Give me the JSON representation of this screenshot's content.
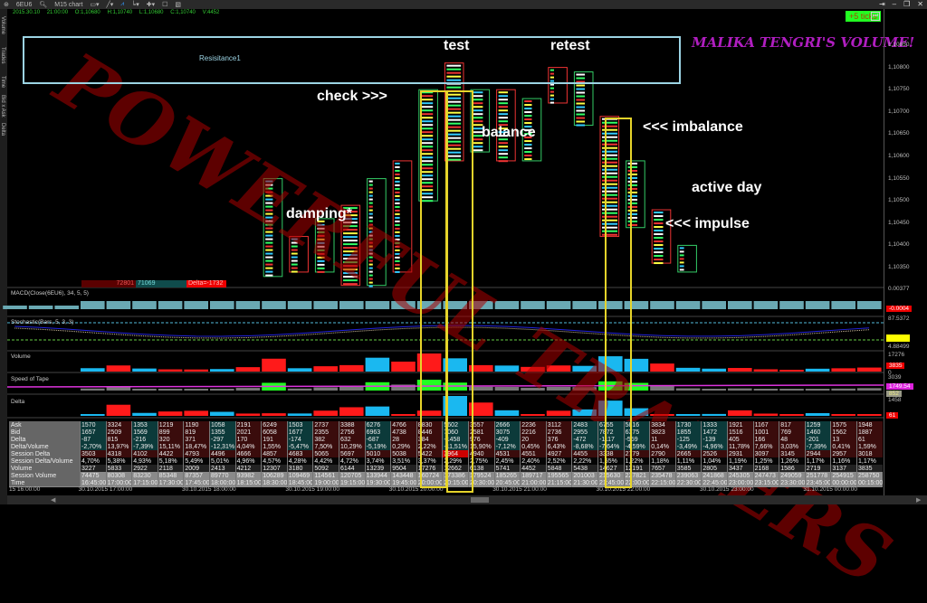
{
  "toolbar": {
    "symbol": "6EU6",
    "chart_type": "M15 chart",
    "items": [
      "search-icon",
      "monitor-icon",
      "draw-icon",
      "indicator-icon",
      "layout-icon",
      "crosshair-icon",
      "window-icon",
      "template-icon"
    ]
  },
  "info": {
    "datetime": "2015.30.10 21:00:00",
    "open": "O:1,10680",
    "high": "H:1,10740",
    "low": "L:1,10680",
    "close": "C:1,10740",
    "volume": "V:4452"
  },
  "left_tabs": [
    "Volume",
    "Trades",
    "Time",
    "Bid x Ask",
    "Delta"
  ],
  "ticks_button": "+5 ticks",
  "title_overlay": "MALIKA TENGRI'S VOLUME!",
  "watermark": "POWERFUL TRADERS",
  "resistance_label": "Resisitance1",
  "annotations": {
    "test": "test",
    "retest": "retest",
    "check": "check >>>",
    "balance": "balance",
    "imbalance": "<<< imbalance",
    "active": "active day",
    "damping": "damping*",
    "impulse": "<<< impulse"
  },
  "price_axis": [
    "1,10850",
    "1,10800",
    "1,10750",
    "1,10700",
    "1,10650",
    "1,10600",
    "1,10550",
    "1,10500",
    "1,10450",
    "1,10400",
    "1,10350"
  ],
  "bottom_bar": {
    "ask_total": "72801",
    "bid_total": "71069",
    "delta": "Delta=-1732"
  },
  "panels": {
    "macd": {
      "title": "MACD(Close(6EU6), 34, 5, 5)",
      "top": "0.00377",
      "value": "-0.0004"
    },
    "stochastic": {
      "title": "Stochastic(Bars, 5, 3, 3)",
      "top": "87.5372",
      "bottom": "4.88499"
    },
    "volume": {
      "title": "Volume",
      "top": "17276",
      "value": "3835",
      "bottom": "0"
    },
    "speed": {
      "title": "Speed of Tape",
      "top": "3039",
      "value": "1749.54",
      "value2": "852"
    },
    "delta": {
      "title": "Delta",
      "top": "1458",
      "value": "61"
    }
  },
  "colors": {
    "positive": "#ff1a1a",
    "negative": "#1ab8f0",
    "resistance": "#9cd4e4",
    "highlight": "#e6d42a",
    "overlay": "#b01ec0"
  },
  "table": {
    "row_labels": [
      "Ask",
      "Bid",
      "Delta",
      "Delta/Volume",
      "Session Delta",
      "Session Delta/Volume",
      "Volume",
      "Session Volume",
      "Time"
    ],
    "ask": [
      "1570",
      "3324",
      "1353",
      "1219",
      "1190",
      "1058",
      "2191",
      "6249",
      "1503",
      "2737",
      "3388",
      "6276",
      "4766",
      "8830",
      "5602",
      "3557",
      "2666",
      "2236",
      "3112",
      "2483",
      "6755",
      "5816",
      "3834",
      "1730",
      "1333",
      "1921",
      "1167",
      "817",
      "1259",
      "1575",
      "1948"
    ],
    "bid": [
      "1657",
      "2509",
      "1569",
      "899",
      "819",
      "1355",
      "2021",
      "6058",
      "1677",
      "2355",
      "2756",
      "6963",
      "4738",
      "8446",
      "7060",
      "2581",
      "3075",
      "2216",
      "2736",
      "2955",
      "7872",
      "6375",
      "3823",
      "1855",
      "1472",
      "1516",
      "1001",
      "769",
      "1460",
      "1562",
      "1887"
    ],
    "delta": [
      "-87",
      "815",
      "-216",
      "320",
      "371",
      "-297",
      "170",
      "191",
      "-174",
      "382",
      "632",
      "-687",
      "28",
      "384",
      "-1458",
      "976",
      "-409",
      "20",
      "376",
      "-472",
      "-1117",
      "-559",
      "11",
      "-125",
      "-139",
      "405",
      "166",
      "48",
      "-201",
      "13",
      "61"
    ],
    "delta_volume": [
      "-2,70%",
      "13,97%",
      "-7,39%",
      "15,11%",
      "18,47%",
      "-12,31%",
      "4,04%",
      "1,55%",
      "-5,47%",
      "7,50%",
      "10,29%",
      "-5,19%",
      "0,29%",
      "2,22%",
      "-11,51%",
      "15,90%",
      "-7,12%",
      "0,45%",
      "6,43%",
      "-8,68%",
      "-7,64%",
      "-4,59%",
      "0,14%",
      "-3,49%",
      "-4,96%",
      "11,78%",
      "7,66%",
      "3,03%",
      "-7,39%",
      "0,41%",
      "1,59%"
    ],
    "session_delta": [
      "3503",
      "4318",
      "4102",
      "4422",
      "4793",
      "4496",
      "4666",
      "4857",
      "4683",
      "5065",
      "5697",
      "5010",
      "5038",
      "5422",
      "3964",
      "4940",
      "4531",
      "4551",
      "4927",
      "4455",
      "3338",
      "2779",
      "2790",
      "2665",
      "2526",
      "2931",
      "3097",
      "3145",
      "2944",
      "2957",
      "3018"
    ],
    "session_delta_volume": [
      "4,70%",
      "5,38%",
      "4,93%",
      "5,18%",
      "5,49%",
      "5,01%",
      "4,96%",
      "4,57%",
      "4,28%",
      "4,42%",
      "4,72%",
      "3,74%",
      "3,51%",
      "3,37%",
      "2,29%",
      "2,75%",
      "2,45%",
      "2,40%",
      "2,52%",
      "2,22%",
      "1,55%",
      "1,22%",
      "1,18%",
      "1,11%",
      "1,04%",
      "1,19%",
      "1,25%",
      "1,26%",
      "1,17%",
      "1,16%",
      "1,17%"
    ],
    "volume": [
      "3227",
      "5833",
      "2922",
      "2118",
      "2009",
      "2413",
      "4212",
      "12307",
      "3180",
      "5092",
      "6144",
      "13239",
      "9504",
      "17276",
      "12662",
      "6138",
      "5741",
      "4452",
      "5848",
      "5438",
      "14627",
      "12191",
      "7657",
      "3585",
      "2805",
      "3437",
      "2168",
      "1586",
      "2719",
      "3137",
      "3835"
    ],
    "session_volume": [
      "74475",
      "80308",
      "83230",
      "85348",
      "87357",
      "89770",
      "93982",
      "106289",
      "109469",
      "114561",
      "120705",
      "133944",
      "143448",
      "160724",
      "173386",
      "179524",
      "185265",
      "189717",
      "195565",
      "201003",
      "215630",
      "227821",
      "235478",
      "239063",
      "241868",
      "245305",
      "247473",
      "249059",
      "251778",
      "254915",
      "258750"
    ],
    "time": [
      "16:45:00",
      "17:00:00",
      "17:15:00",
      "17:30:00",
      "17:45:00",
      "18:00:00",
      "18:15:00",
      "18:30:00",
      "18:45:00",
      "19:00:00",
      "19:15:00",
      "19:30:00",
      "19:45:00",
      "20:00:00",
      "20:15:00",
      "20:30:00",
      "20:45:00",
      "21:00:00",
      "21:15:00",
      "21:30:00",
      "21:45:00",
      "22:00:00",
      "22:15:00",
      "22:30:00",
      "22:45:00",
      "23:00:00",
      "23:15:00",
      "23:30:00",
      "23:45:00",
      "00:00:00",
      "00:15:00"
    ]
  },
  "clusters": [
    {
      "time": "18:30:00",
      "high": 1.1055,
      "low": 1.1033
    },
    {
      "time": "18:45:00",
      "high": 1.1042,
      "low": 1.1034
    },
    {
      "time": "19:00:00",
      "high": 1.1046,
      "low": 1.1034
    },
    {
      "time": "19:15:00",
      "high": 1.1049,
      "low": 1.1031
    },
    {
      "time": "19:30:00",
      "high": 1.1055,
      "low": 1.1031
    },
    {
      "time": "19:45:00",
      "high": 1.1059,
      "low": 1.1034
    },
    {
      "time": "20:00:00",
      "high": 1.1075,
      "low": 1.105
    },
    {
      "time": "20:15:00",
      "high": 1.1081,
      "low": 1.1059
    },
    {
      "time": "20:30:00",
      "high": 1.1075,
      "low": 1.1061
    },
    {
      "time": "20:45:00",
      "high": 1.1075,
      "low": 1.1059
    },
    {
      "time": "21:00:00",
      "high": 1.1073,
      "low": 1.1059
    },
    {
      "time": "21:15:00",
      "high": 1.108,
      "low": 1.1072
    },
    {
      "time": "21:30:00",
      "high": 1.1079,
      "low": 1.1067
    },
    {
      "time": "21:45:00",
      "high": 1.1069,
      "low": 1.1042
    },
    {
      "time": "22:00:00",
      "high": 1.1059,
      "low": 1.1044
    },
    {
      "time": "22:15:00",
      "high": 1.1048,
      "low": 1.1036
    },
    {
      "time": "22:30:00",
      "high": 1.104,
      "low": 1.1034
    }
  ],
  "time_axis": [
    "15 16:00:00",
    "30.10.2015 17:00:00",
    "30.10.2015 18:00:00",
    "30.10.2015 19:00:00",
    "30.10.2015 20:00:00",
    "30.10.2015 21:00:00",
    "30.10.2015 22:00:00",
    "30.10.2015 23:00:00",
    "31.10.2015 00:00:00"
  ]
}
